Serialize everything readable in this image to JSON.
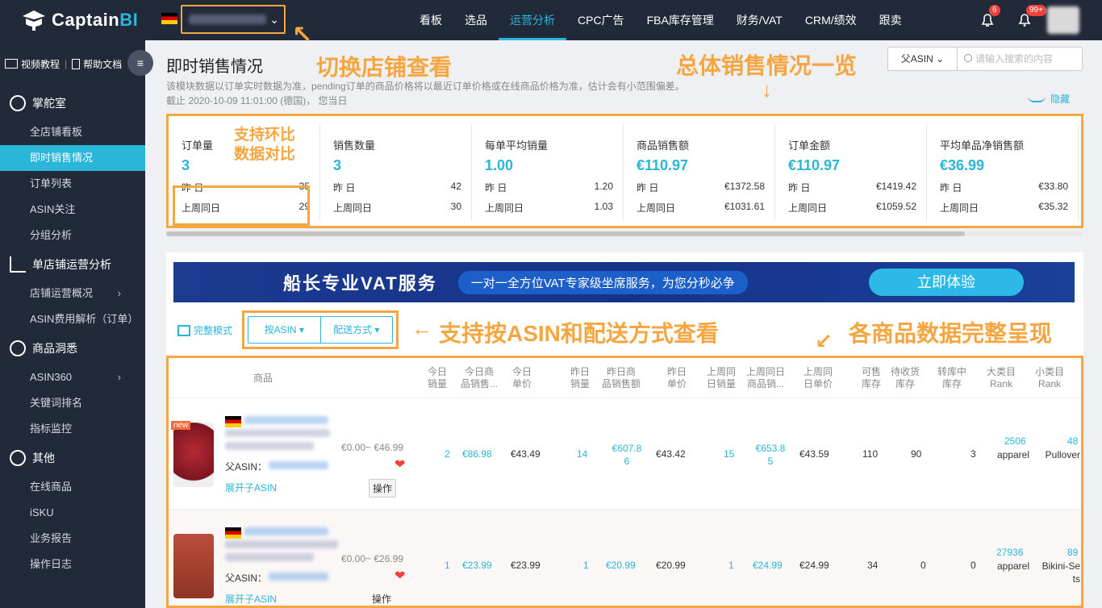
{
  "header": {
    "logo_text": "Captain",
    "logo_text_bi": "BI",
    "nav": [
      "看板",
      "选品",
      "运营分析",
      "CPC广告",
      "FBA库存管理",
      "财务/VAT",
      "CRM/绩效",
      "跟卖"
    ],
    "active_nav": "运营分析",
    "bell1_badge": "6",
    "bell2_badge": "99+"
  },
  "sidebar": {
    "video": "视频教程",
    "help": "帮助文档",
    "groups": [
      {
        "label": "掌舵室",
        "items": [
          "全店铺看板",
          "即时销售情况",
          "订单列表",
          "ASIN关注",
          "分组分析"
        ]
      },
      {
        "label": "单店铺运营分析",
        "items": [
          "店铺运营概况",
          "ASIN费用解析（订单）"
        ]
      },
      {
        "label": "商品洞悉",
        "items": [
          "ASIN360",
          "关键词排名",
          "指标监控"
        ]
      },
      {
        "label": "其他",
        "items": [
          "在线商品",
          "iSKU",
          "业务报告",
          "操作日志"
        ]
      }
    ]
  },
  "page": {
    "title": "即时销售情况",
    "desc": "该模块数据以订单实时数据为准，pending订单的商品价格将以最近订单价格或在线商品价格为准，估计会有小范围偏差。",
    "date": "截止 2020-10-09 11:01:00 (德国)，  您当日",
    "search_select": "父ASIN",
    "search_placeholder": "请输入搜索的内容",
    "hide": "隐藏"
  },
  "annotations": {
    "switch_store": "切换店铺查看",
    "overview": "总体销售情况一览",
    "compare": "支持环比\n数据对比",
    "filter": "支持按ASIN和配送方式查看",
    "complete": "各商品数据完整呈现"
  },
  "cards": [
    {
      "title": "订单量",
      "value": "3",
      "r1l": "昨      日",
      "r1v": "35",
      "r2l": "上周同日",
      "r2v": "29"
    },
    {
      "title": "销售数量",
      "value": "3",
      "r1l": "昨      日",
      "r1v": "42",
      "r2l": "上周同日",
      "r2v": "30"
    },
    {
      "title": "每单平均销量",
      "value": "1.00",
      "r1l": "昨      日",
      "r1v": "1.20",
      "r2l": "上周同日",
      "r2v": "1.03"
    },
    {
      "title": "商品销售额",
      "value": "€110.97",
      "r1l": "昨      日",
      "r1v": "€1372.58",
      "r2l": "上周同日",
      "r2v": "€1031.61"
    },
    {
      "title": "订单金额",
      "value": "€110.97",
      "r1l": "昨      日",
      "r1v": "€1419.42",
      "r2l": "上周同日",
      "r2v": "€1059.52"
    },
    {
      "title": "平均单品净销售额",
      "value": "€36.99",
      "r1l": "昨      日",
      "r1v": "€33.80",
      "r2l": "上周同日",
      "r2v": "€35.32"
    }
  ],
  "banner": {
    "title": "船长专业VAT服务",
    "sub": "一对一全方位VAT专家级坐席服务，为您分秒必争",
    "cta": "立即体验"
  },
  "filters": {
    "mode": "完整模式",
    "by_asin": "按ASIN",
    "by_ship": "配送方式"
  },
  "table": {
    "headers": [
      "商品",
      "今日\n销量",
      "今日商\n品销售...",
      "今日\n单价",
      "昨日\n销量",
      "昨日商\n品销售额",
      "昨日\n单价",
      "上周同\n日销量",
      "上周同日\n商品销...",
      "上周同\n日单价",
      "可售\n库存",
      "待收货\n库存",
      "转库中\n库存",
      "大类目\nRank",
      "小类目\nRank"
    ],
    "rows": [
      {
        "new": "new",
        "price": "€0.00~ €46.99",
        "parent": "父ASIN：",
        "expand": "展开子ASIN",
        "op": "操作",
        "vals": [
          "2",
          "€86.98",
          "€43.49",
          "14",
          "€607.86",
          "€43.42",
          "15",
          "€653.85",
          "€43.59",
          "110",
          "90",
          "3",
          "2506",
          "apparel",
          "48",
          "Pullover"
        ]
      },
      {
        "new": "",
        "price": "€0.00~ €26.99",
        "parent": "父ASIN：",
        "expand": "展开子ASIN",
        "op": "操作",
        "vals": [
          "1",
          "€23.99",
          "€23.99",
          "1",
          "€20.99",
          "€20.99",
          "1",
          "€24.99",
          "€24.99",
          "34",
          "0",
          "0",
          "27936",
          "apparel",
          "89",
          "Bikini-Sets"
        ]
      }
    ]
  },
  "colors": {
    "accent": "#29b6d8",
    "annotation": "#f5a641",
    "nav_bg": "#222a3a"
  }
}
